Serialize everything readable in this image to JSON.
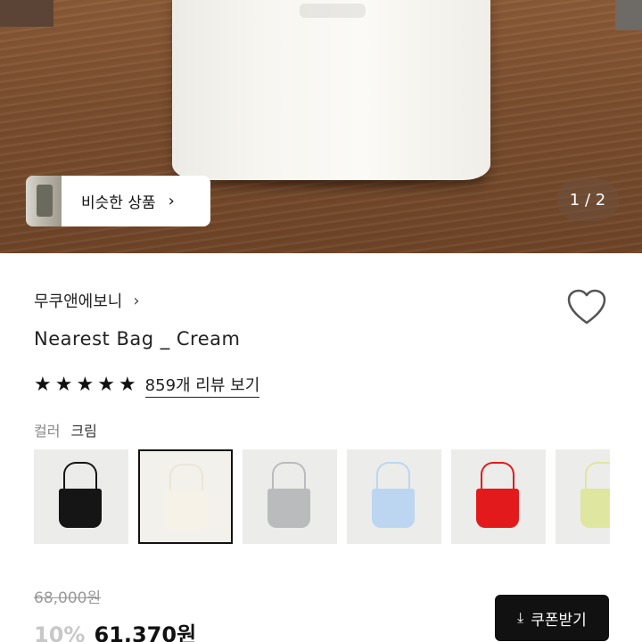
{
  "hero": {
    "similar_label": "비슷한 상품",
    "page_indicator": "1 / 2"
  },
  "product": {
    "brand": "무쿠앤에보니",
    "title": "Nearest Bag _ Cream",
    "rating_stars": 5,
    "reviews_link": "859개 리뷰 보기",
    "color_label": "컬러",
    "color_value": "크림",
    "swatches": [
      {
        "color": "#151515",
        "selected": false
      },
      {
        "color": "#f3ecdf",
        "selected": true
      },
      {
        "color": "#b9bbbc",
        "selected": false
      },
      {
        "color": "#bcd6f2",
        "selected": false
      },
      {
        "color": "#e31a1c",
        "selected": false
      },
      {
        "color": "#dfe6a0",
        "selected": false
      }
    ]
  },
  "pricing": {
    "original_price": "68,000원",
    "discount": "10%",
    "sale_price": "61,370원",
    "coupon_label": "쿠폰받기"
  },
  "icons": {
    "similar_chevron": "chevron-right-icon",
    "brand_chevron": "chevron-right-icon",
    "heart": "heart-outline-icon",
    "star": "star-filled-icon",
    "download": "download-icon"
  }
}
